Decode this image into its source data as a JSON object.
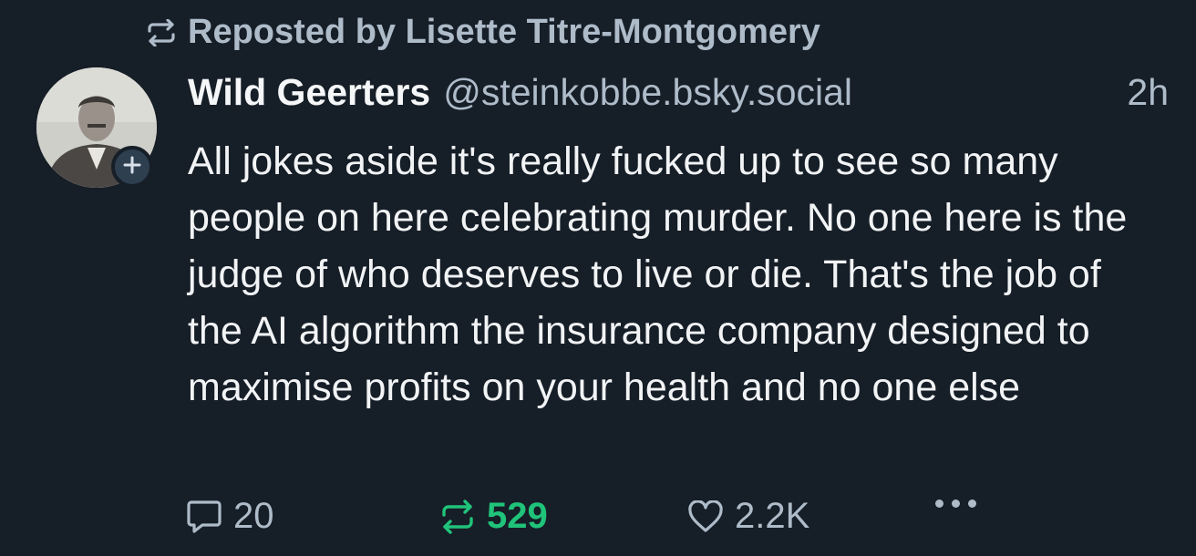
{
  "repost": {
    "icon": "repost-icon",
    "text": "Reposted by Lisette Titre-Montgomery"
  },
  "author": {
    "display_name": "Wild Geerters",
    "handle": "@steinkobbe.bsky.social",
    "avatar_icon": "avatar-portrait",
    "follow_icon": "plus-icon"
  },
  "post": {
    "timestamp": "2h",
    "text": "All jokes aside it's really fucked up to see so many people on here celebrating murder. No one here is the judge of who deserves to live or die. That's the job of the AI algorithm the insurance company designed to maximise profits on your health and no one else"
  },
  "actions": {
    "reply_count": "20",
    "repost_count": "529",
    "like_count": "2.2K",
    "reply_icon": "reply-bubble-icon",
    "repost_icon": "repost-icon",
    "like_icon": "heart-icon",
    "more_icon": "more-dots-icon"
  },
  "colors": {
    "background": "#161e27",
    "muted_text": "#aebbc9",
    "primary_text": "#f1f3f5",
    "repost_active": "#20c37a"
  }
}
